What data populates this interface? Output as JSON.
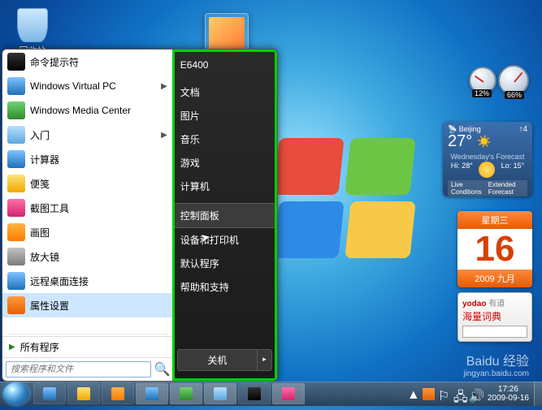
{
  "desktop": {
    "recycle_bin": "回收站"
  },
  "start": {
    "items": [
      {
        "label": "命令提示符",
        "ico": "c1",
        "chev": false
      },
      {
        "label": "Windows Virtual PC",
        "ico": "c2",
        "chev": true
      },
      {
        "label": "Windows Media Center",
        "ico": "c4",
        "chev": false
      },
      {
        "label": "入门",
        "ico": "c5",
        "chev": true
      },
      {
        "label": "计算器",
        "ico": "c2",
        "chev": false
      },
      {
        "label": "便笺",
        "ico": "c7",
        "chev": false
      },
      {
        "label": "截图工具",
        "ico": "c6",
        "chev": false
      },
      {
        "label": "画图",
        "ico": "c3",
        "chev": false
      },
      {
        "label": "放大镜",
        "ico": "c8",
        "chev": false
      },
      {
        "label": "远程桌面连接",
        "ico": "c2",
        "chev": false
      },
      {
        "label": "属性设置",
        "ico": "c9",
        "chev": false
      }
    ],
    "selected_index": 10,
    "all_programs": "所有程序",
    "search_placeholder": "搜索程序和文件",
    "right": [
      "E6400",
      "文档",
      "图片",
      "音乐",
      "游戏",
      "计算机",
      "控制面板",
      "设备和打印机",
      "默认程序",
      "帮助和支持"
    ],
    "right_highlight_index": 6,
    "shutdown": "关机"
  },
  "taskbar": {
    "tray_time": "17:26",
    "tray_date": "2009-09-16"
  },
  "gadgets": {
    "meter": {
      "pct1": "12%",
      "pct2": "66%"
    },
    "weather": {
      "city": "Beijing",
      "temp": "27°",
      "wind_icon": "4",
      "forecast_label": "Wednesday's Forecast",
      "hi": "Hi: 28°",
      "lo": "Lo: 15°",
      "ext": "Extended Forecast",
      "live": "Live Conditions"
    },
    "date": {
      "weekday": "星期三",
      "day": "16",
      "monthyear": "2009 九月"
    },
    "dict": {
      "brand_red": "yodao",
      "brand_grey": "有道",
      "sub": "海量词典"
    }
  },
  "watermark": {
    "big": "Baidu 经验",
    "small": "jingyan.baidu.com"
  }
}
